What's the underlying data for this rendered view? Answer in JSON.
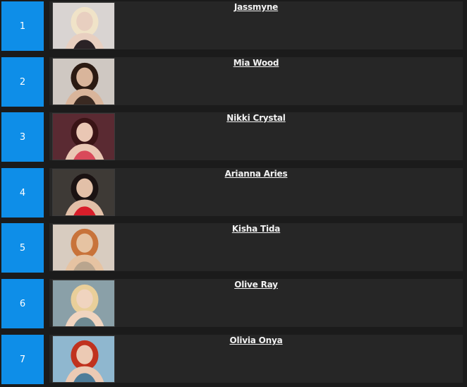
{
  "colors": {
    "rank_bg": "#0e8ee8",
    "row_bg": "#262626",
    "page_bg": "#1b1b1b",
    "text": "#f2f2f2"
  },
  "items": [
    {
      "rank": "1",
      "name": "Jassmyne",
      "thumb_icon": "profile-photo",
      "thumb_bg": "#d9d4d2",
      "skin": "#e8cfc0",
      "hair": "#f0e3c8",
      "accent": "#2a2226"
    },
    {
      "rank": "2",
      "name": "Mia Wood",
      "thumb_icon": "profile-photo",
      "thumb_bg": "#cfc8c2",
      "skin": "#d9b59b",
      "hair": "#2b1a12",
      "accent": "#3a2a22"
    },
    {
      "rank": "3",
      "name": "Nikki Crystal",
      "thumb_icon": "profile-photo",
      "thumb_bg": "#5a2a32",
      "skin": "#eac7b4",
      "hair": "#3a1416",
      "accent": "#d94a5a"
    },
    {
      "rank": "4",
      "name": "Arianna Aries",
      "thumb_icon": "profile-photo",
      "thumb_bg": "#3e3a36",
      "skin": "#e2c0a8",
      "hair": "#1a1212",
      "accent": "#d81e2a"
    },
    {
      "rank": "5",
      "name": "Kisha Tida",
      "thumb_icon": "profile-photo",
      "thumb_bg": "#d8ccc0",
      "skin": "#e6c3a2",
      "hair": "#c8733a",
      "accent": "#b9a58e"
    },
    {
      "rank": "6",
      "name": "Olive Ray",
      "thumb_icon": "profile-photo",
      "thumb_bg": "#8aa0a8",
      "skin": "#f0d4bf",
      "hair": "#e9cf9a",
      "accent": "#6e8a92"
    },
    {
      "rank": "7",
      "name": "Olivia Onya",
      "thumb_icon": "profile-photo",
      "thumb_bg": "#8fb7cf",
      "skin": "#eccab4",
      "hair": "#c0321e",
      "accent": "#4e7d9a"
    }
  ]
}
